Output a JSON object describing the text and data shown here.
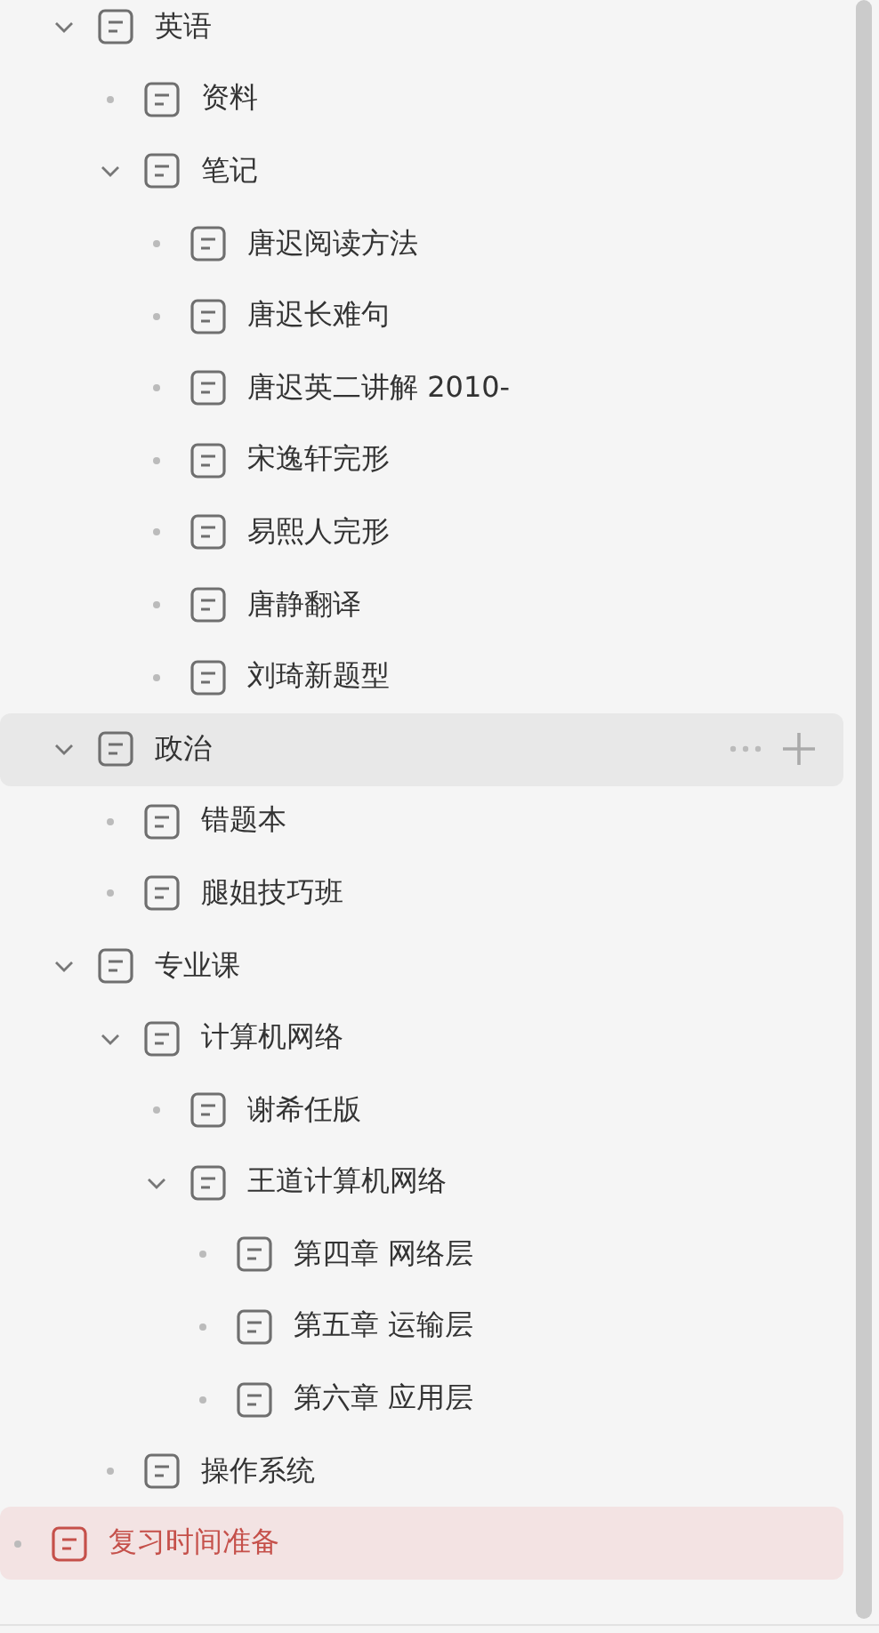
{
  "tree": [
    {
      "children": [
        {
          "label": "英语",
          "expanded": true,
          "selected": false,
          "hovered": false,
          "children": [
            {
              "label": "资料",
              "selected": false,
              "hovered": false
            },
            {
              "label": "笔记",
              "expanded": true,
              "selected": false,
              "hovered": false,
              "children": [
                {
                  "label": "唐迟阅读方法",
                  "selected": false,
                  "hovered": false
                },
                {
                  "label": "唐迟长难句",
                  "selected": false,
                  "hovered": false
                },
                {
                  "label": "唐迟英二讲解 2010-",
                  "selected": false,
                  "hovered": false
                },
                {
                  "label": "宋逸轩完形",
                  "selected": false,
                  "hovered": false
                },
                {
                  "label": "易熙人完形",
                  "selected": false,
                  "hovered": false
                },
                {
                  "label": "唐静翻译",
                  "selected": false,
                  "hovered": false
                },
                {
                  "label": "刘琦新题型",
                  "selected": false,
                  "hovered": false
                }
              ]
            }
          ]
        },
        {
          "label": "政治",
          "expanded": true,
          "selected": false,
          "hovered": true,
          "children": [
            {
              "label": "错题本",
              "selected": false,
              "hovered": false
            },
            {
              "label": "腿姐技巧班",
              "selected": false,
              "hovered": false
            }
          ]
        },
        {
          "label": "专业课",
          "expanded": true,
          "selected": false,
          "hovered": false,
          "children": [
            {
              "label": "计算机网络",
              "expanded": true,
              "selected": false,
              "hovered": false,
              "children": [
                {
                  "label": "谢希任版",
                  "selected": false,
                  "hovered": false
                },
                {
                  "label": "王道计算机网络",
                  "expanded": true,
                  "selected": false,
                  "hovered": false,
                  "children": [
                    {
                      "label": "第四章 网络层",
                      "selected": false,
                      "hovered": false
                    },
                    {
                      "label": "第五章 运输层",
                      "selected": false,
                      "hovered": false
                    },
                    {
                      "label": "第六章 应用层",
                      "selected": false,
                      "hovered": false
                    }
                  ]
                }
              ]
            },
            {
              "label": "操作系统",
              "selected": false,
              "hovered": false
            }
          ]
        }
      ]
    },
    {
      "label": "复习时间准备",
      "selected": true,
      "hovered": false
    }
  ]
}
